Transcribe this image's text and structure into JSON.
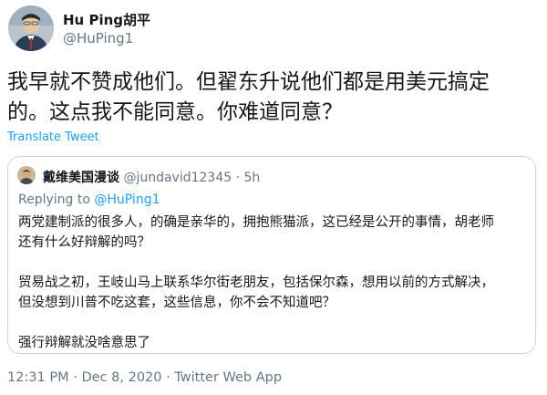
{
  "author": {
    "display_name": "Hu Ping胡平",
    "handle": "@HuPing1"
  },
  "tweet": {
    "text_line1": "我早就不赞成他们。但翟东升说他们都是用美元搞定",
    "text_line2": "的。这点我不能同意。你难道同意？",
    "translate_label": "Translate Tweet"
  },
  "quote": {
    "display_name": "戴维美国漫谈",
    "handle": "@jundavid12345",
    "separator": "·",
    "time": "5h",
    "replying_prefix": "Replying to",
    "replying_handle": "@HuPing1",
    "paragraph1_line1": "两党建制派的很多人，的确是亲华的，拥抱熊猫派，这已经是公开的事情，胡老师",
    "paragraph1_line2": "还有什么好辩解的吗？",
    "paragraph2_line1": "贸易战之初，王岐山马上联系华尔街老朋友，包括保尔森，想用以前的方式解决，",
    "paragraph2_line2": "但没想到川普不吃这套，这些信息，你不会不知道吧？",
    "paragraph3": "强行辩解就没啥意思了"
  },
  "meta": {
    "timestamp": "12:31 PM · Dec 8, 2020 · Twitter Web App"
  },
  "colors": {
    "link": "#1da1f2",
    "secondary_text": "#657786",
    "border": "#ccd6dd"
  }
}
